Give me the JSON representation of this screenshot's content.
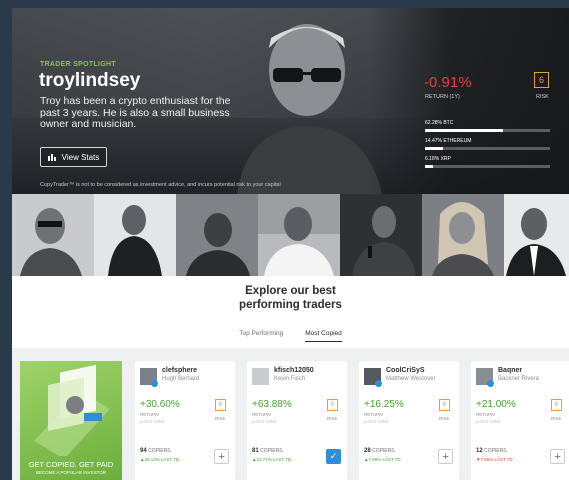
{
  "spotlight": {
    "label": "TRADER SPOTLIGHT",
    "name": "troylindsey",
    "bio": "Troy has been a crypto enthusiast for the past 3 years. He is also a small business owner and musician.",
    "view_stats": "View Stats",
    "disclaimer": "CopyTrader™ is not to be considered as investment advice, and incurs potential risk to your capital",
    "return_value": "-0.91%",
    "return_label": "RETURN (1Y)",
    "risk_value": "6",
    "risk_label": "RISK",
    "allocations": [
      {
        "text": "62.28% BTC",
        "pct": 62.28
      },
      {
        "text": "14.47% ETHEREUM",
        "pct": 14.47
      },
      {
        "text": "6.18% XRP",
        "pct": 6.18
      }
    ]
  },
  "explore": {
    "title_line1": "Explore our best",
    "title_line2": "performing traders",
    "tabs": [
      "Top Performing",
      "Most Copied"
    ],
    "active_tab": "Most Copied"
  },
  "promo": {
    "headline": "GET COPIED. GET PAID",
    "subline": "BECOME A POPULAR INVESTOR"
  },
  "cards": [
    {
      "username": "clefsphere",
      "fullname": "Hugh Bernard",
      "return": "+30.60%",
      "return_label": "RETURN",
      "return_sub": "(LAST 12M)",
      "risk": "6",
      "risk_label": "RISK",
      "copiers": "94",
      "copiers_label": "COPIERS",
      "change": "▲25.13% LAST 7D",
      "change_negative": false,
      "copied": false
    },
    {
      "username": "kfisch12050",
      "fullname": "Kevin Fisch",
      "return": "+63.88%",
      "return_label": "RETURN",
      "return_sub": "(LAST 12M)",
      "risk": "5",
      "risk_label": "RISK",
      "copiers": "81",
      "copiers_label": "COPIERS",
      "change": "▲13.71% LAST 7D",
      "change_negative": false,
      "copied": true
    },
    {
      "username": "CoolCriSyS",
      "fullname": "Matthew Westover",
      "return": "+16.25%",
      "return_label": "RETURN",
      "return_sub": "(LAST 12M)",
      "risk": "6",
      "risk_label": "RISK",
      "copiers": "28",
      "copiers_label": "COPIERS",
      "change": "▲7.69% LAST 7D",
      "change_negative": false,
      "copied": false
    },
    {
      "username": "Baqner",
      "fullname": "Backner Rivera",
      "return": "+21.00%",
      "return_label": "RETURN",
      "return_sub": "(LAST 12M)",
      "risk": "6",
      "risk_label": "RISK",
      "copiers": "12",
      "copiers_label": "COPIERS",
      "change": "▼7.65% LAST 7D",
      "change_negative": true,
      "copied": false
    }
  ],
  "colors": {
    "accent_green": "#8cc63f",
    "positive": "#43a22f",
    "negative": "#e8413b",
    "risk": "#e6a52a",
    "copy_blue": "#2e8ed8"
  }
}
